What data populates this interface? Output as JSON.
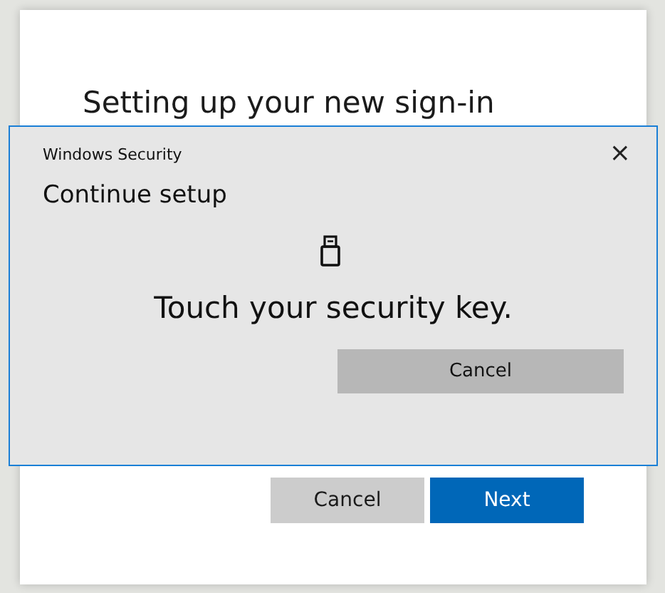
{
  "background_page": {
    "heading": "Setting up your new sign-in",
    "buttons": [
      {
        "label": "Cancel",
        "kind": "secondary"
      },
      {
        "label": "Next",
        "kind": "primary"
      }
    ]
  },
  "dialog": {
    "title": "Windows Security",
    "close": "×",
    "heading": "Continue setup",
    "message": "Touch your security key.",
    "buttons": [
      {
        "label": "Cancel",
        "kind": "secondary"
      }
    ]
  }
}
